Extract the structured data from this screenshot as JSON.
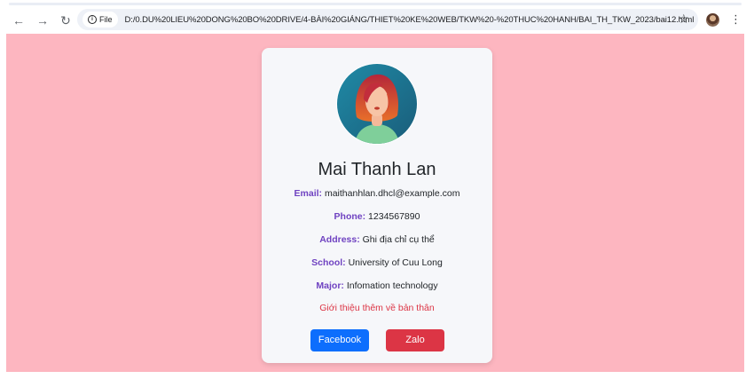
{
  "browser": {
    "site_chip": "File",
    "url": "D:/0.DU%20LIEU%20DONG%20BO%20DRIVE/4-BÀI%20GIẢNG/THIET%20KE%20WEB/TKW%20-%20THUC%20HANH/BAI_TH_TKW_2023/bai12.html",
    "icons": [
      "back-arrow-icon",
      "forward-arrow-icon",
      "reload-icon",
      "info-icon",
      "star-icon",
      "profile-avatar",
      "kebab-menu-icon"
    ]
  },
  "profile": {
    "name": "Mai Thanh Lan",
    "fields": [
      {
        "label": "Email:",
        "value": "maithanhlan.dhcl@example.com"
      },
      {
        "label": "Phone:",
        "value": "1234567890"
      },
      {
        "label": "Address:",
        "value": "Ghi địa chỉ cụ thể"
      },
      {
        "label": "School:",
        "value": "University of Cuu Long"
      },
      {
        "label": "Major:",
        "value": "Infomation technology"
      }
    ],
    "intro": "Giới thiệu thêm về bản thân",
    "buttons": {
      "facebook": "Facebook",
      "zalo": "Zalo"
    }
  },
  "colors": {
    "page_background": "#fdb6c0",
    "card_background": "#f6f7fa",
    "label": "#6f42c1",
    "intro_text": "#dc3545",
    "facebook_button": "#0d6efd",
    "zalo_button": "#dc3545"
  }
}
